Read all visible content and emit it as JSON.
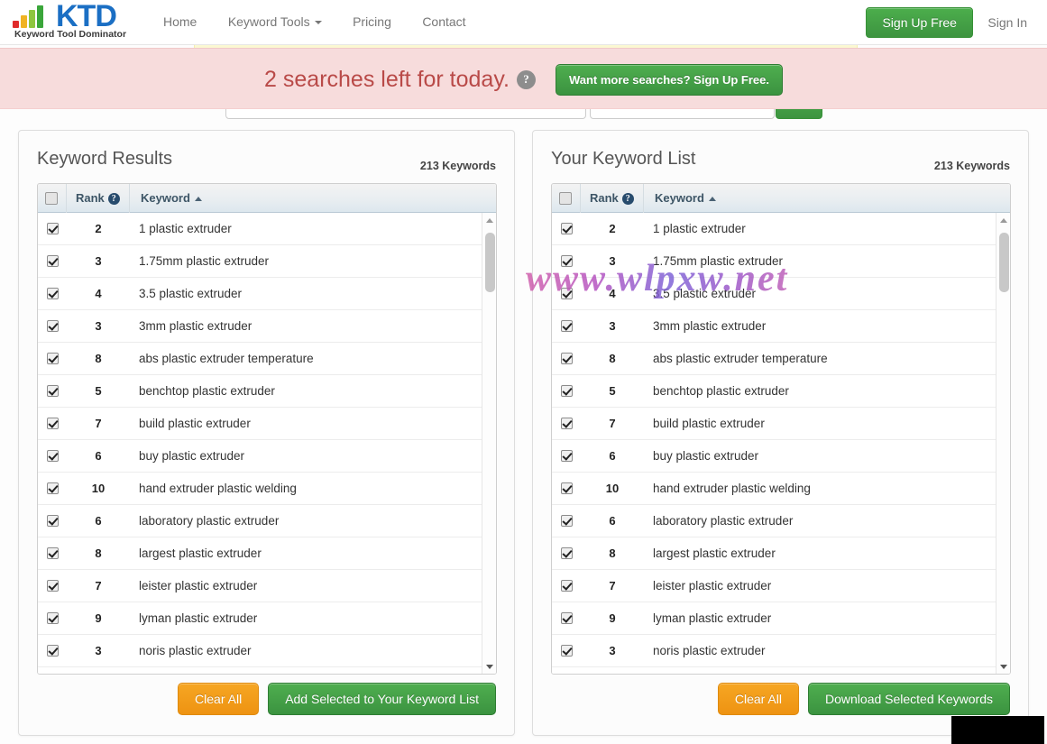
{
  "navbar": {
    "logo": {
      "abbr": "KTD",
      "tagline": "Keyword Tool Dominator"
    },
    "links": [
      {
        "label": "Home",
        "has_caret": false
      },
      {
        "label": "Keyword Tools",
        "has_caret": true
      },
      {
        "label": "Pricing",
        "has_caret": false
      },
      {
        "label": "Contact",
        "has_caret": false
      }
    ],
    "signup_label": "Sign Up Free",
    "signin_label": "Sign In"
  },
  "banner": {
    "message": "2 searches left for today.",
    "help_glyph": "?",
    "cta_label": "Want more searches? Sign Up Free.",
    "background_color": "#f7dcdc",
    "text_color": "#b94a48"
  },
  "search_form": {
    "keyword_value": "",
    "keyword_placeholder": "",
    "secondary_value": "",
    "secondary_placeholder": "",
    "go_label": ""
  },
  "watermark": {
    "text": "www.wlpxw.net"
  },
  "panels": [
    {
      "id": "keyword-results",
      "title": "Keyword Results",
      "count_label": "213 Keywords",
      "columns": {
        "checkbox": "",
        "rank": "Rank",
        "rank_help_glyph": "?",
        "keyword": "Keyword",
        "keyword_sort": "asc"
      },
      "rows": [
        {
          "checked": true,
          "rank": "2",
          "keyword": "1 plastic extruder"
        },
        {
          "checked": true,
          "rank": "3",
          "keyword": "1.75mm plastic extruder"
        },
        {
          "checked": true,
          "rank": "4",
          "keyword": "3.5 plastic extruder"
        },
        {
          "checked": true,
          "rank": "3",
          "keyword": "3mm plastic extruder"
        },
        {
          "checked": true,
          "rank": "8",
          "keyword": "abs plastic extruder temperature"
        },
        {
          "checked": true,
          "rank": "5",
          "keyword": "benchtop plastic extruder"
        },
        {
          "checked": true,
          "rank": "7",
          "keyword": "build plastic extruder"
        },
        {
          "checked": true,
          "rank": "6",
          "keyword": "buy plastic extruder"
        },
        {
          "checked": true,
          "rank": "10",
          "keyword": "hand extruder plastic welding"
        },
        {
          "checked": true,
          "rank": "6",
          "keyword": "laboratory plastic extruder"
        },
        {
          "checked": true,
          "rank": "8",
          "keyword": "largest plastic extruder"
        },
        {
          "checked": true,
          "rank": "7",
          "keyword": "leister plastic extruder"
        },
        {
          "checked": true,
          "rank": "9",
          "keyword": "lyman plastic extruder"
        },
        {
          "checked": true,
          "rank": "3",
          "keyword": "noris plastic extruder"
        }
      ],
      "actions": {
        "clear_label": "Clear All",
        "primary_label": "Add Selected to Your Keyword List"
      }
    },
    {
      "id": "your-keyword-list",
      "title": "Your Keyword List",
      "count_label": "213 Keywords",
      "columns": {
        "checkbox": "",
        "rank": "Rank",
        "rank_help_glyph": "?",
        "keyword": "Keyword",
        "keyword_sort": "asc"
      },
      "rows": [
        {
          "checked": true,
          "rank": "2",
          "keyword": "1 plastic extruder"
        },
        {
          "checked": true,
          "rank": "3",
          "keyword": "1.75mm plastic extruder"
        },
        {
          "checked": true,
          "rank": "4",
          "keyword": "3.5 plastic extruder"
        },
        {
          "checked": true,
          "rank": "3",
          "keyword": "3mm plastic extruder"
        },
        {
          "checked": true,
          "rank": "8",
          "keyword": "abs plastic extruder temperature"
        },
        {
          "checked": true,
          "rank": "5",
          "keyword": "benchtop plastic extruder"
        },
        {
          "checked": true,
          "rank": "7",
          "keyword": "build plastic extruder"
        },
        {
          "checked": true,
          "rank": "6",
          "keyword": "buy plastic extruder"
        },
        {
          "checked": true,
          "rank": "10",
          "keyword": "hand extruder plastic welding"
        },
        {
          "checked": true,
          "rank": "6",
          "keyword": "laboratory plastic extruder"
        },
        {
          "checked": true,
          "rank": "8",
          "keyword": "largest plastic extruder"
        },
        {
          "checked": true,
          "rank": "7",
          "keyword": "leister plastic extruder"
        },
        {
          "checked": true,
          "rank": "9",
          "keyword": "lyman plastic extruder"
        },
        {
          "checked": true,
          "rank": "3",
          "keyword": "noris plastic extruder"
        }
      ],
      "actions": {
        "clear_label": "Clear All",
        "primary_label": "Download Selected Keywords"
      }
    }
  ],
  "colors": {
    "brand_blue": "#1b6fc4",
    "green": "#3d9440",
    "orange": "#ee9312",
    "banner_pink": "#f7dcdc",
    "banner_text": "#b94a48"
  }
}
